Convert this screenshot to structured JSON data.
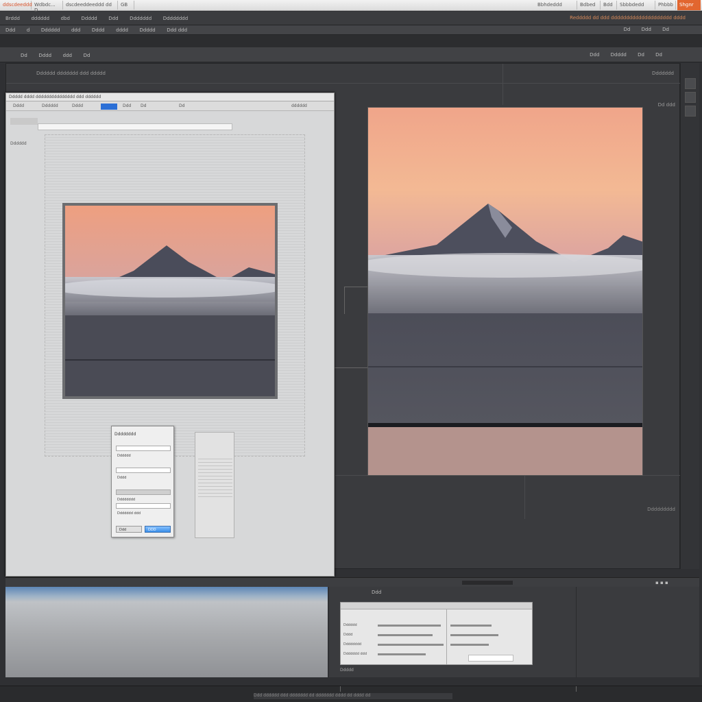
{
  "topbar": {
    "tabs": [
      "ddscdeeddd",
      "Wdbdc... D",
      "dscdeeddeeddd dd",
      "GB"
    ],
    "right_items": [
      "Bbhdeddd",
      "Bdbed",
      "Bdd",
      "Sbbbdedd",
      "Phbbb"
    ],
    "corner": "Shgnr"
  },
  "menubar": {
    "items": [
      "Brddd",
      "dddddd",
      "dbd",
      "Ddddd",
      "Ddd",
      "Ddddddd",
      "Dddddddd"
    ],
    "right_text": "Reddddd dd ddd dddddddddddddddddddd dddd"
  },
  "optionsbar": {
    "items": [
      "Ddd",
      "d",
      "Dddddd",
      "ddd",
      "Dddd",
      "dddd",
      "Ddddd",
      "Ddd ddd"
    ],
    "right_items": [
      "Dd",
      "d",
      "Ddd",
      "d",
      "Dd"
    ]
  },
  "toolbar3": {
    "items": [
      "Dd",
      "Dddd",
      "ddd",
      "Dd"
    ],
    "right_items": [
      "Ddd",
      "Ddddd",
      "Dd",
      "Dd"
    ]
  },
  "canvas": {
    "doc_title": "Dddddd ddddddd ddd ddddd",
    "corner_label": "Ddddddd",
    "side_label": "Dd ddd",
    "zoom_label": "Ddddddddd"
  },
  "left_panel": {
    "header": "Ddddd  dddd ddddddddddddddd ddd dddddd",
    "tools": [
      "Dddd",
      "Dddddd",
      "Dddd",
      "Ddd",
      "Dd",
      "Dd",
      "dddddd"
    ],
    "side_label": "Dddddd"
  },
  "dialog": {
    "title": "Dddddddd",
    "fields": [
      "Dddddd",
      "Dddd",
      "Dddddddd",
      "Ddddddd ddd",
      "Dddddd"
    ],
    "ok_label": "DDD",
    "cancel_label": "Ddd"
  },
  "bottom_panel": {
    "title": "Ddd",
    "footer": "Ddddd",
    "dialog_rows": [
      "Dddddd",
      "Dddd",
      "Dddddddd",
      "Ddddddd ddd"
    ]
  },
  "statusbar": {
    "text": "Ddd dddddd ddd ddddddd dd ddddddd dddd dd dddd dd"
  },
  "colors": {
    "accent": "#e2662f",
    "selection_blue": "#2b6fd6",
    "sky_top": "#f3a88a",
    "sky_bottom": "#d99a98"
  }
}
